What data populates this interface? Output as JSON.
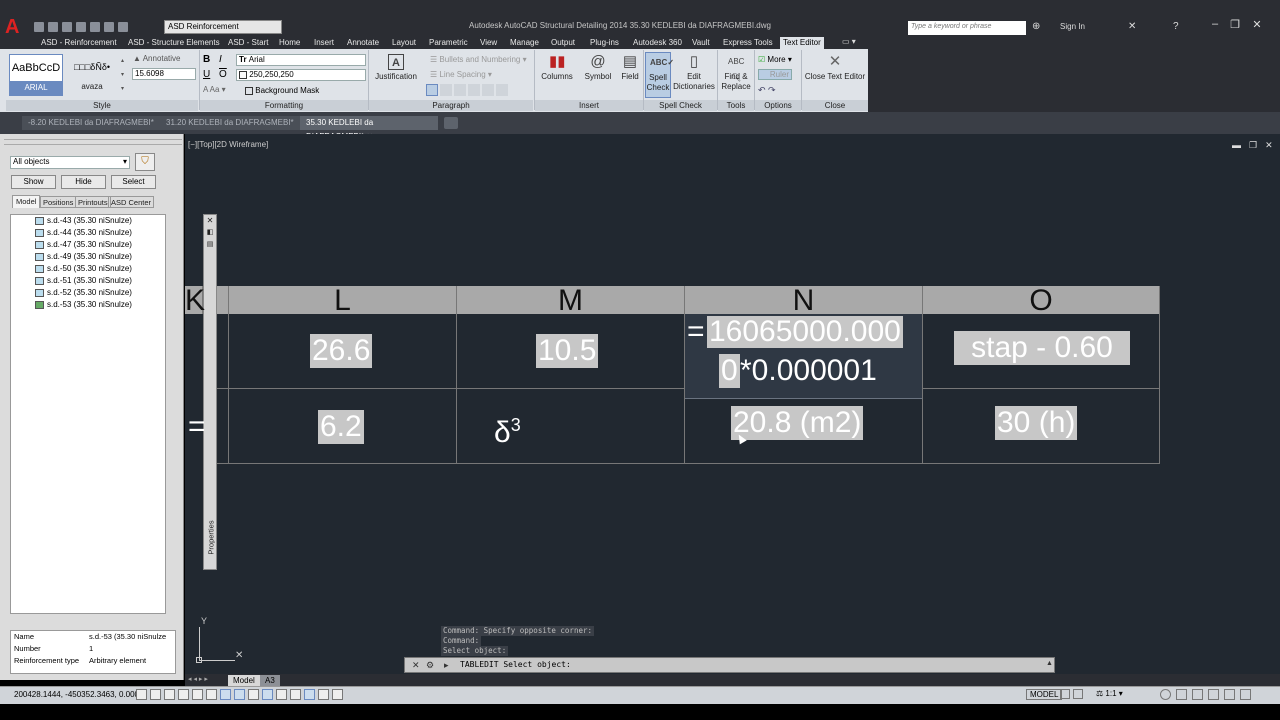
{
  "app": {
    "title": "Autodesk AutoCAD Structural Detailing 2014   35.30 KEDLEBI da DIAFRAGMEBI.dwg",
    "workspace": "ASD Reinforcement",
    "search_placeholder": "Type a keyword or phrase",
    "sign_in": "Sign In"
  },
  "ribbon_tabs": [
    "ASD - Reinforcement",
    "ASD - Structure Elements",
    "ASD - Start",
    "Home",
    "Insert",
    "Annotate",
    "Layout",
    "Parametric",
    "View",
    "Manage",
    "Output",
    "Plug-ins",
    "Autodesk 360",
    "Vault",
    "Express Tools",
    "Text Editor"
  ],
  "ribbon": {
    "style": {
      "panel": "Style",
      "style1_preview": "AaBbCcD",
      "style1_name": "ARIAL",
      "style2_preview": "□□□δÑδ•",
      "style2_name": "avaza",
      "annotative": "Annotative",
      "height": "15.6098"
    },
    "formatting": {
      "panel": "Formatting",
      "font": "Arial",
      "color": "250,250,250",
      "background_mask": "Background Mask"
    },
    "paragraph": {
      "panel": "Paragraph",
      "justification": "Justification",
      "bullets": "Bullets and Numbering",
      "line_spacing": "Line Spacing"
    },
    "insert": {
      "panel": "Insert",
      "columns": "Columns",
      "symbol": "Symbol",
      "field": "Field"
    },
    "spell": {
      "panel": "Spell Check",
      "spell_check": "Spell Check",
      "edit_dictionaries": "Edit Dictionaries"
    },
    "tools": {
      "panel": "Tools",
      "find_replace": "Find & Replace"
    },
    "options": {
      "panel": "Options",
      "more": "More",
      "ruler": "Ruler"
    },
    "close": {
      "panel": "Close",
      "close_editor": "Close Text Editor"
    }
  },
  "doc_tabs": [
    "-8.20 KEDLEBI da DIAFRAGMEBI*",
    "31.20 KEDLEBI da DIAFRAGMEBI*",
    "35.30 KEDLEBI da DIAFRAGMEBI*"
  ],
  "left_palette": {
    "filter": "All objects",
    "buttons": [
      "Show",
      "Hide",
      "Select"
    ],
    "tabs": [
      "Model",
      "Positions",
      "Printouts",
      "ASD Center"
    ],
    "tree_items": [
      "s.d.-43 (35.30 niSnulze)",
      "s.d.-44 (35.30 niSnulze)",
      "s.d.-47 (35.30 niSnulze)",
      "s.d.-49 (35.30 niSnulze)",
      "s.d.-50 (35.30 niSnulze)",
      "s.d.-51 (35.30 niSnulze)",
      "s.d.-52 (35.30 niSnulze)",
      "s.d.-53 (35.30 niSnulze)"
    ],
    "properties": [
      {
        "name": "Name",
        "value": "s.d.-53 (35.30 niSnulze"
      },
      {
        "name": "Number",
        "value": "1"
      },
      {
        "name": "Reinforcement type",
        "value": "Arbitrary element"
      }
    ]
  },
  "viewport": {
    "label": "[−][Top][2D Wireframe]",
    "properties_label": "Properties"
  },
  "table": {
    "headers": [
      "K",
      "L",
      "M",
      "N",
      "O"
    ],
    "row1": {
      "L": "26.6",
      "M": "10.5",
      "N_line1_prefix": "=",
      "N_line1": "16065000.000",
      "N_line2_hl": "0",
      "N_line2": "*0.000001",
      "O": "stap -  0.60"
    },
    "row2": {
      "K": "=",
      "L": "6.2",
      "M": "δ",
      "M_sup": "3",
      "N": "20.8 (m2)",
      "O": "30 (h)"
    }
  },
  "command": {
    "history": [
      "Command: Specify opposite corner:",
      "Command:",
      "Select object:"
    ],
    "prompt": "TABLEDIT Select object:"
  },
  "layout_tabs": [
    "Model",
    "A3"
  ],
  "status": {
    "coords": "200428.1444, -450352.3463, 0.0000",
    "model": "MODEL",
    "scale": "1:1"
  }
}
